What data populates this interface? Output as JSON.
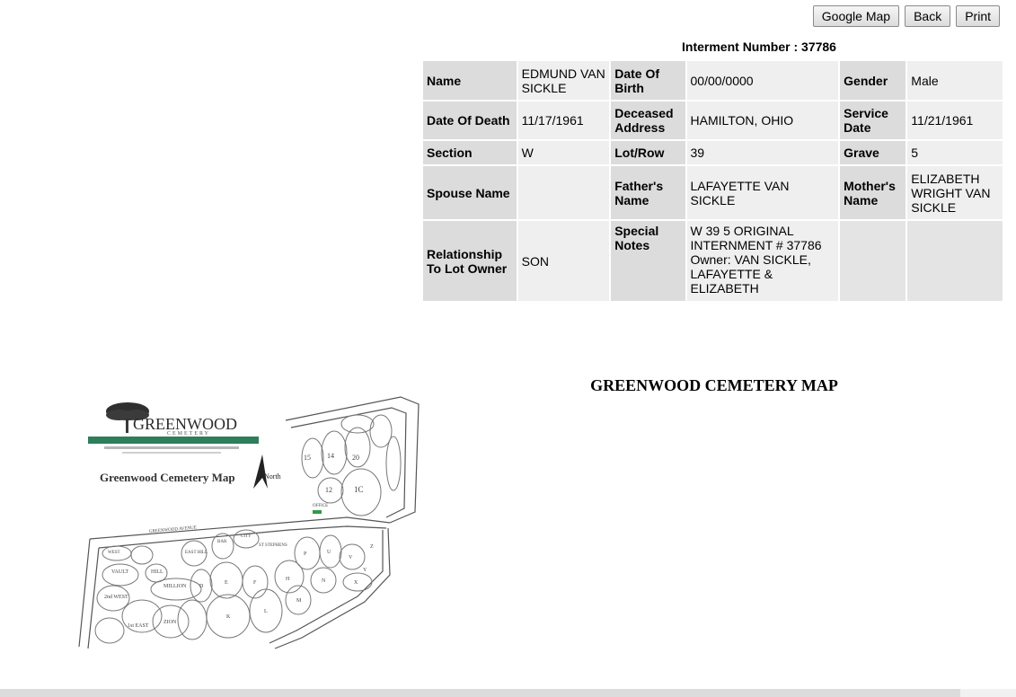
{
  "toolbar": {
    "google_map": "Google Map",
    "back": "Back",
    "print": "Print"
  },
  "interment": "Interment Number : 37786",
  "record": {
    "name_label": "Name",
    "name": "EDMUND VAN SICKLE",
    "dob_label": "Date Of Birth",
    "dob": "00/00/0000",
    "gender_label": "Gender",
    "gender": "Male",
    "dod_label": "Date Of Death",
    "dod": "11/17/1961",
    "address_label": "Deceased Address",
    "address": "HAMILTON, OHIO",
    "service_label": "Service Date",
    "service": "11/21/1961",
    "section_label": "Section",
    "section": "W",
    "lot_label": "Lot/Row",
    "lot": "39",
    "grave_label": "Grave",
    "grave": "5",
    "spouse_label": "Spouse Name",
    "spouse": "",
    "father_label": "Father's Name",
    "father": "LAFAYETTE VAN SICKLE",
    "mother_label": "Mother's Name",
    "mother": "ELIZABETH WRIGHT VAN SICKLE",
    "relationship_label": "Relationship To Lot Owner",
    "relationship": "SON",
    "notes_label": "Special Notes",
    "notes": "W 39 5 ORIGINAL INTERNMENT # 37786 Owner: VAN SICKLE, LAFAYETTE & ELIZABETH"
  },
  "map_title": "GREENWOOD CEMETERY MAP",
  "map": {
    "brand": "GREENWOOD",
    "brand_sub": "CEMETERY",
    "caption": "Greenwood Cemetery Map",
    "north": "North",
    "avenue": "GREENWOOD AVENUE",
    "office": "OFFICE",
    "sections": [
      "15",
      "14",
      "20",
      "12",
      "1C",
      "WEST",
      "VAULT",
      "HILL",
      "MILLION",
      "2nd WEST",
      "1st EAST",
      "ZION",
      "EAST HILL",
      "BAR",
      "CITY",
      "ST STEPHENS",
      "D",
      "E",
      "F",
      "H",
      "K",
      "L",
      "M",
      "N",
      "P",
      "U",
      "V",
      "X",
      "Y",
      "Z"
    ],
    "brand_color": "#2e7d5b"
  }
}
